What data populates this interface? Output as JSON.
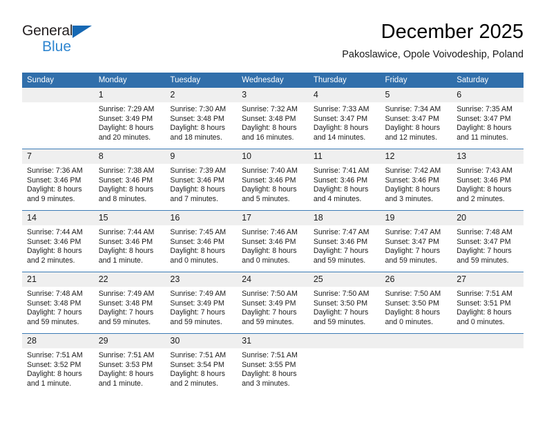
{
  "brand": {
    "name_part1": "General",
    "name_part2": "Blue",
    "logo_icon": "triangle-icon",
    "colors": {
      "dark": "#231f20",
      "blue": "#2f86d0",
      "triangle": "#1668b3"
    }
  },
  "header": {
    "title": "December 2025",
    "subtitle": "Pakoslawice, Opole Voivodeship, Poland"
  },
  "calendar": {
    "header_bg": "#316fab",
    "daynum_bg": "#efefef",
    "weekdays": [
      "Sunday",
      "Monday",
      "Tuesday",
      "Wednesday",
      "Thursday",
      "Friday",
      "Saturday"
    ],
    "weeks": [
      [
        {
          "day": "",
          "sunrise": "",
          "sunset": "",
          "daylight1": "",
          "daylight2": ""
        },
        {
          "day": "1",
          "sunrise": "Sunrise: 7:29 AM",
          "sunset": "Sunset: 3:49 PM",
          "daylight1": "Daylight: 8 hours",
          "daylight2": "and 20 minutes."
        },
        {
          "day": "2",
          "sunrise": "Sunrise: 7:30 AM",
          "sunset": "Sunset: 3:48 PM",
          "daylight1": "Daylight: 8 hours",
          "daylight2": "and 18 minutes."
        },
        {
          "day": "3",
          "sunrise": "Sunrise: 7:32 AM",
          "sunset": "Sunset: 3:48 PM",
          "daylight1": "Daylight: 8 hours",
          "daylight2": "and 16 minutes."
        },
        {
          "day": "4",
          "sunrise": "Sunrise: 7:33 AM",
          "sunset": "Sunset: 3:47 PM",
          "daylight1": "Daylight: 8 hours",
          "daylight2": "and 14 minutes."
        },
        {
          "day": "5",
          "sunrise": "Sunrise: 7:34 AM",
          "sunset": "Sunset: 3:47 PM",
          "daylight1": "Daylight: 8 hours",
          "daylight2": "and 12 minutes."
        },
        {
          "day": "6",
          "sunrise": "Sunrise: 7:35 AM",
          "sunset": "Sunset: 3:47 PM",
          "daylight1": "Daylight: 8 hours",
          "daylight2": "and 11 minutes."
        }
      ],
      [
        {
          "day": "7",
          "sunrise": "Sunrise: 7:36 AM",
          "sunset": "Sunset: 3:46 PM",
          "daylight1": "Daylight: 8 hours",
          "daylight2": "and 9 minutes."
        },
        {
          "day": "8",
          "sunrise": "Sunrise: 7:38 AM",
          "sunset": "Sunset: 3:46 PM",
          "daylight1": "Daylight: 8 hours",
          "daylight2": "and 8 minutes."
        },
        {
          "day": "9",
          "sunrise": "Sunrise: 7:39 AM",
          "sunset": "Sunset: 3:46 PM",
          "daylight1": "Daylight: 8 hours",
          "daylight2": "and 7 minutes."
        },
        {
          "day": "10",
          "sunrise": "Sunrise: 7:40 AM",
          "sunset": "Sunset: 3:46 PM",
          "daylight1": "Daylight: 8 hours",
          "daylight2": "and 5 minutes."
        },
        {
          "day": "11",
          "sunrise": "Sunrise: 7:41 AM",
          "sunset": "Sunset: 3:46 PM",
          "daylight1": "Daylight: 8 hours",
          "daylight2": "and 4 minutes."
        },
        {
          "day": "12",
          "sunrise": "Sunrise: 7:42 AM",
          "sunset": "Sunset: 3:46 PM",
          "daylight1": "Daylight: 8 hours",
          "daylight2": "and 3 minutes."
        },
        {
          "day": "13",
          "sunrise": "Sunrise: 7:43 AM",
          "sunset": "Sunset: 3:46 PM",
          "daylight1": "Daylight: 8 hours",
          "daylight2": "and 2 minutes."
        }
      ],
      [
        {
          "day": "14",
          "sunrise": "Sunrise: 7:44 AM",
          "sunset": "Sunset: 3:46 PM",
          "daylight1": "Daylight: 8 hours",
          "daylight2": "and 2 minutes."
        },
        {
          "day": "15",
          "sunrise": "Sunrise: 7:44 AM",
          "sunset": "Sunset: 3:46 PM",
          "daylight1": "Daylight: 8 hours",
          "daylight2": "and 1 minute."
        },
        {
          "day": "16",
          "sunrise": "Sunrise: 7:45 AM",
          "sunset": "Sunset: 3:46 PM",
          "daylight1": "Daylight: 8 hours",
          "daylight2": "and 0 minutes."
        },
        {
          "day": "17",
          "sunrise": "Sunrise: 7:46 AM",
          "sunset": "Sunset: 3:46 PM",
          "daylight1": "Daylight: 8 hours",
          "daylight2": "and 0 minutes."
        },
        {
          "day": "18",
          "sunrise": "Sunrise: 7:47 AM",
          "sunset": "Sunset: 3:46 PM",
          "daylight1": "Daylight: 7 hours",
          "daylight2": "and 59 minutes."
        },
        {
          "day": "19",
          "sunrise": "Sunrise: 7:47 AM",
          "sunset": "Sunset: 3:47 PM",
          "daylight1": "Daylight: 7 hours",
          "daylight2": "and 59 minutes."
        },
        {
          "day": "20",
          "sunrise": "Sunrise: 7:48 AM",
          "sunset": "Sunset: 3:47 PM",
          "daylight1": "Daylight: 7 hours",
          "daylight2": "and 59 minutes."
        }
      ],
      [
        {
          "day": "21",
          "sunrise": "Sunrise: 7:48 AM",
          "sunset": "Sunset: 3:48 PM",
          "daylight1": "Daylight: 7 hours",
          "daylight2": "and 59 minutes."
        },
        {
          "day": "22",
          "sunrise": "Sunrise: 7:49 AM",
          "sunset": "Sunset: 3:48 PM",
          "daylight1": "Daylight: 7 hours",
          "daylight2": "and 59 minutes."
        },
        {
          "day": "23",
          "sunrise": "Sunrise: 7:49 AM",
          "sunset": "Sunset: 3:49 PM",
          "daylight1": "Daylight: 7 hours",
          "daylight2": "and 59 minutes."
        },
        {
          "day": "24",
          "sunrise": "Sunrise: 7:50 AM",
          "sunset": "Sunset: 3:49 PM",
          "daylight1": "Daylight: 7 hours",
          "daylight2": "and 59 minutes."
        },
        {
          "day": "25",
          "sunrise": "Sunrise: 7:50 AM",
          "sunset": "Sunset: 3:50 PM",
          "daylight1": "Daylight: 7 hours",
          "daylight2": "and 59 minutes."
        },
        {
          "day": "26",
          "sunrise": "Sunrise: 7:50 AM",
          "sunset": "Sunset: 3:50 PM",
          "daylight1": "Daylight: 8 hours",
          "daylight2": "and 0 minutes."
        },
        {
          "day": "27",
          "sunrise": "Sunrise: 7:51 AM",
          "sunset": "Sunset: 3:51 PM",
          "daylight1": "Daylight: 8 hours",
          "daylight2": "and 0 minutes."
        }
      ],
      [
        {
          "day": "28",
          "sunrise": "Sunrise: 7:51 AM",
          "sunset": "Sunset: 3:52 PM",
          "daylight1": "Daylight: 8 hours",
          "daylight2": "and 1 minute."
        },
        {
          "day": "29",
          "sunrise": "Sunrise: 7:51 AM",
          "sunset": "Sunset: 3:53 PM",
          "daylight1": "Daylight: 8 hours",
          "daylight2": "and 1 minute."
        },
        {
          "day": "30",
          "sunrise": "Sunrise: 7:51 AM",
          "sunset": "Sunset: 3:54 PM",
          "daylight1": "Daylight: 8 hours",
          "daylight2": "and 2 minutes."
        },
        {
          "day": "31",
          "sunrise": "Sunrise: 7:51 AM",
          "sunset": "Sunset: 3:55 PM",
          "daylight1": "Daylight: 8 hours",
          "daylight2": "and 3 minutes."
        },
        {
          "day": "",
          "sunrise": "",
          "sunset": "",
          "daylight1": "",
          "daylight2": ""
        },
        {
          "day": "",
          "sunrise": "",
          "sunset": "",
          "daylight1": "",
          "daylight2": ""
        },
        {
          "day": "",
          "sunrise": "",
          "sunset": "",
          "daylight1": "",
          "daylight2": ""
        }
      ]
    ]
  }
}
